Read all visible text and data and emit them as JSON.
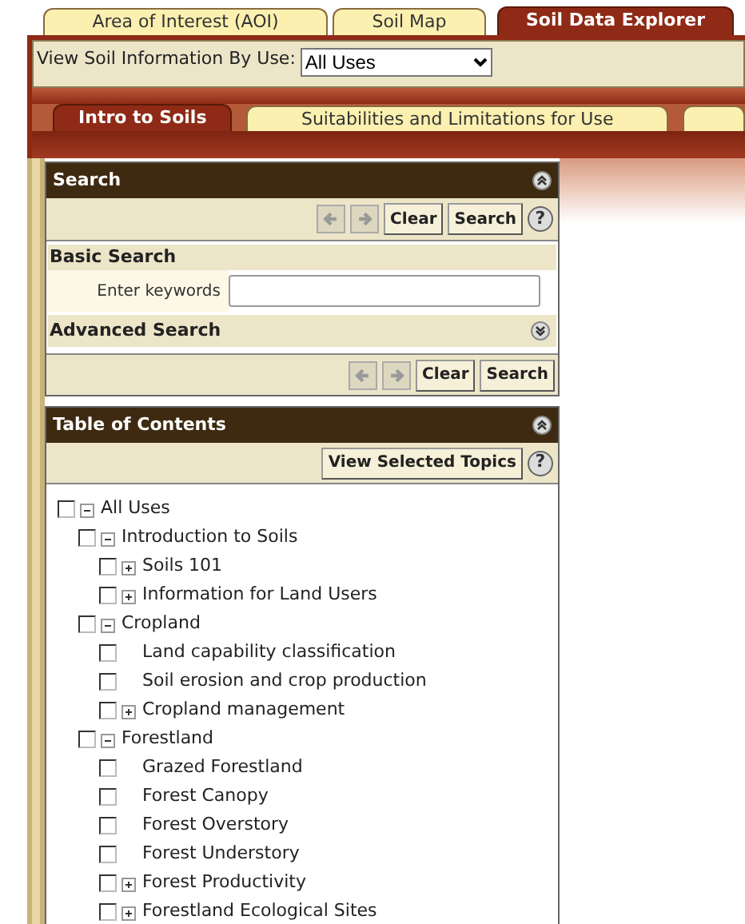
{
  "top_tabs": [
    {
      "label": "Area of Interest (AOI)",
      "selected": false
    },
    {
      "label": "Soil Map",
      "selected": false
    },
    {
      "label": "Soil Data Explorer",
      "selected": true
    }
  ],
  "view_by_use": {
    "label": "View Soil Information By Use:",
    "value": "All Uses"
  },
  "sub_tabs": [
    {
      "label": "Intro to Soils",
      "selected": true
    },
    {
      "label": "Suitabilities and Limitations for Use",
      "selected": false
    },
    {
      "selected": false
    }
  ],
  "search_panel": {
    "title": "Search",
    "expanded": true,
    "toolbar": {
      "buttons": [
        "Clear",
        "Search"
      ],
      "help": "?"
    },
    "basic_search": {
      "title": "Basic Search",
      "keywords_label": "Enter keywords"
    },
    "advanced_search": {
      "title": "Advanced Search",
      "expanded": false
    },
    "bottom_toolbar": {
      "buttons": [
        "Clear",
        "Search"
      ]
    }
  },
  "toc_panel": {
    "title": "Table of Contents",
    "expanded": true,
    "view_button": "View Selected Topics",
    "help": "?",
    "tree": [
      {
        "label": "All Uses",
        "checked": false,
        "expanded": true,
        "children": [
          {
            "label": "Introduction to Soils",
            "checked": false,
            "expanded": true,
            "children": [
              {
                "label": "Soils 101",
                "checked": false,
                "expanded": false
              },
              {
                "label": "Information for Land Users",
                "checked": false,
                "expanded": false
              }
            ]
          },
          {
            "label": "Cropland",
            "checked": false,
            "expanded": true,
            "children": [
              {
                "label": "Land capability classification",
                "checked": false
              },
              {
                "label": "Soil erosion and crop production",
                "checked": false
              },
              {
                "label": "Cropland management",
                "checked": false,
                "expanded": false
              }
            ]
          },
          {
            "label": "Forestland",
            "checked": false,
            "expanded": true,
            "children": [
              {
                "label": "Grazed Forestland",
                "checked": false
              },
              {
                "label": "Forest Canopy",
                "checked": false
              },
              {
                "label": "Forest Overstory",
                "checked": false
              },
              {
                "label": "Forest Understory",
                "checked": false
              },
              {
                "label": "Forest Productivity",
                "checked": false,
                "expanded": false
              },
              {
                "label": "Forestland Ecological Sites",
                "checked": false,
                "expanded": false
              }
            ]
          }
        ]
      }
    ]
  }
}
